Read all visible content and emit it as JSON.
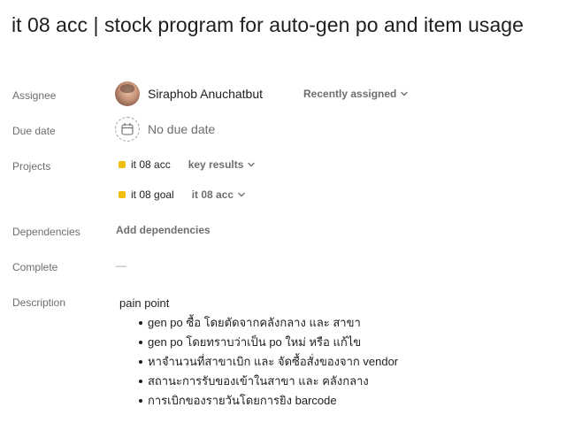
{
  "task": {
    "title": "it 08 acc | stock program for auto-gen po and item usage"
  },
  "labels": {
    "assignee": "Assignee",
    "due_date": "Due date",
    "projects": "Projects",
    "dependencies": "Dependencies",
    "complete": "Complete",
    "description": "Description"
  },
  "assignee": {
    "name": "Siraphob Anuchatbut",
    "avatar_icon": "user-avatar-photo",
    "sort_dropdown": "Recently assigned"
  },
  "due_date": {
    "value": "No due date",
    "icon": "calendar-icon"
  },
  "projects": [
    {
      "name": "it 08 acc",
      "section": "key results",
      "color": "#f1bd0b"
    },
    {
      "name": "it 08 goal",
      "section": "it 08 acc",
      "color": "#f1bd0b"
    }
  ],
  "dependencies": {
    "action": "Add dependencies"
  },
  "complete": {
    "value": "—"
  },
  "description": {
    "heading": "pain point",
    "items": [
      "gen po ซื้อ โดยตัดจากคลังกลาง และ สาขา",
      "gen po โดยทราบว่าเป็น po ใหม่ หรือ แก้ไข",
      "หาจำนวนที่สาขาเบิก และ จัดซื้อสั่งของจาก vendor",
      "สถานะการรับของเข้าในสาขา และ คลังกลาง",
      "การเบิกของรายวันโดยการยิง  barcode"
    ]
  },
  "colors": {
    "text_primary": "#1e1f21",
    "text_secondary": "#6d6e6f",
    "project_yellow": "#f1bd0b"
  }
}
